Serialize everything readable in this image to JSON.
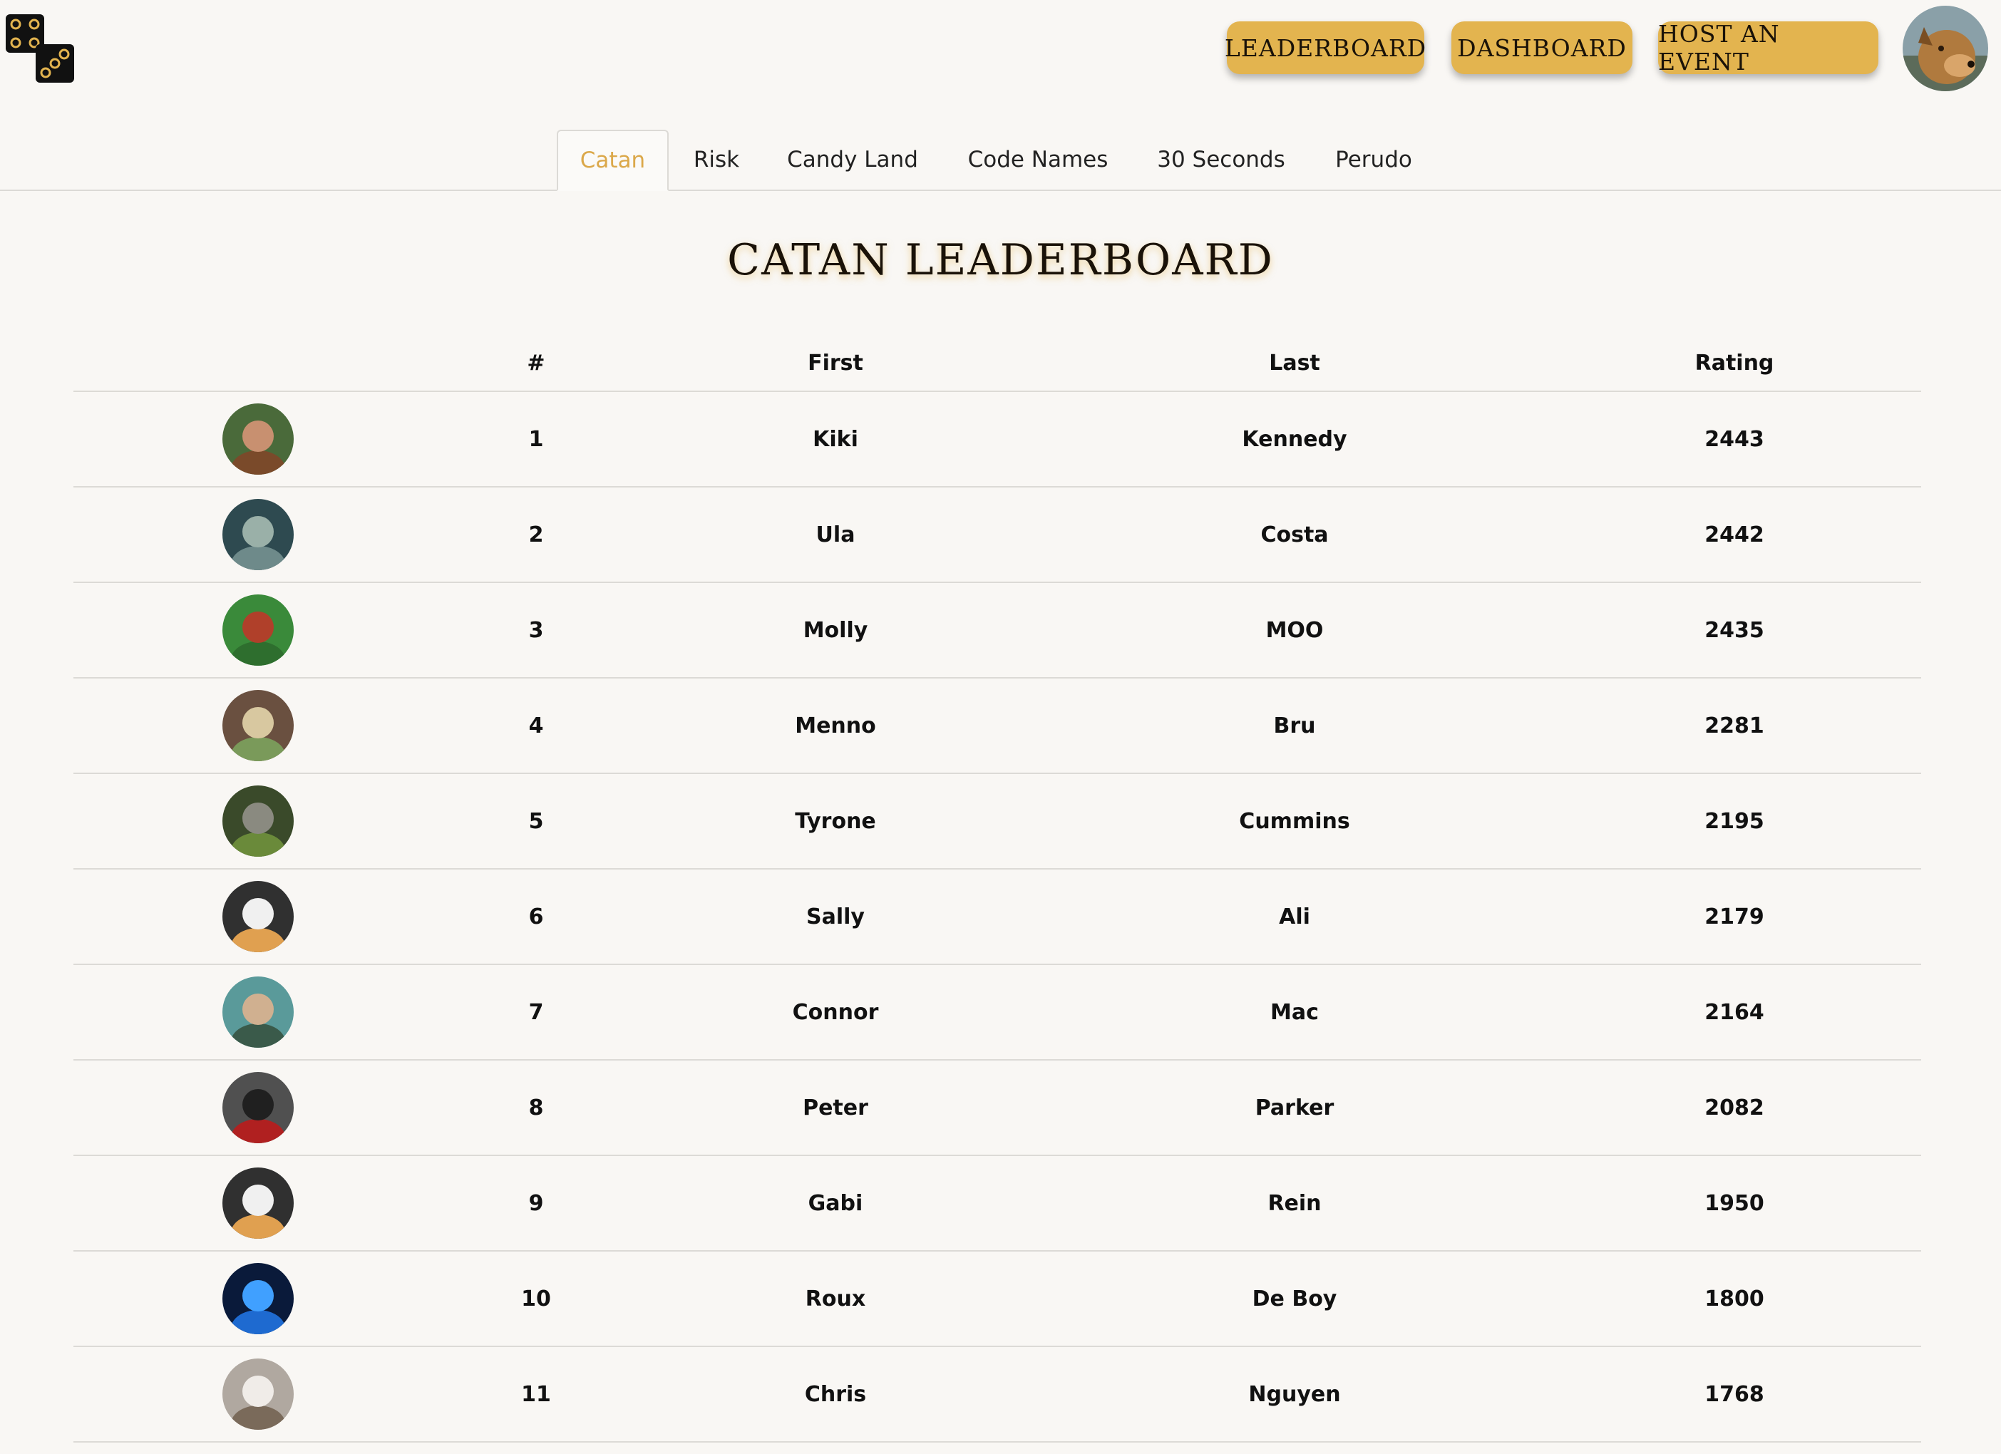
{
  "header": {
    "nav": {
      "leaderboard": "LEADERBOARD",
      "dashboard": "DASHBOARD",
      "host_event": "HOST AN EVENT"
    }
  },
  "tabs": [
    "Catan",
    "Risk",
    "Candy Land",
    "Code Names",
    "30 Seconds",
    "Perudo"
  ],
  "active_tab": "Catan",
  "title": "CATAN LEADERBOARD",
  "table": {
    "columns": [
      "#",
      "First",
      "Last",
      "Rating"
    ],
    "rows": [
      {
        "rank": "1",
        "first": "Kiki",
        "last": "Kennedy",
        "rating": "2443"
      },
      {
        "rank": "2",
        "first": "Ula",
        "last": "Costa",
        "rating": "2442"
      },
      {
        "rank": "3",
        "first": "Molly",
        "last": "MOO",
        "rating": "2435"
      },
      {
        "rank": "4",
        "first": "Menno",
        "last": "Bru",
        "rating": "2281"
      },
      {
        "rank": "5",
        "first": "Tyrone",
        "last": "Cummins",
        "rating": "2195"
      },
      {
        "rank": "6",
        "first": "Sally",
        "last": "Ali",
        "rating": "2179"
      },
      {
        "rank": "7",
        "first": "Connor",
        "last": "Mac",
        "rating": "2164"
      },
      {
        "rank": "8",
        "first": "Peter",
        "last": "Parker",
        "rating": "2082"
      },
      {
        "rank": "9",
        "first": "Gabi",
        "last": "Rein",
        "rating": "1950"
      },
      {
        "rank": "10",
        "first": "Roux",
        "last": "De Boy",
        "rating": "1800"
      },
      {
        "rank": "11",
        "first": "Chris",
        "last": "Nguyen",
        "rating": "1768"
      }
    ]
  },
  "colors": {
    "accent": "#e3b44f",
    "active_tab_text": "#dba84a",
    "background": "#f9f7f4"
  },
  "icons": {
    "logo": "dice-logo-icon",
    "profile": "profile-avatar"
  }
}
